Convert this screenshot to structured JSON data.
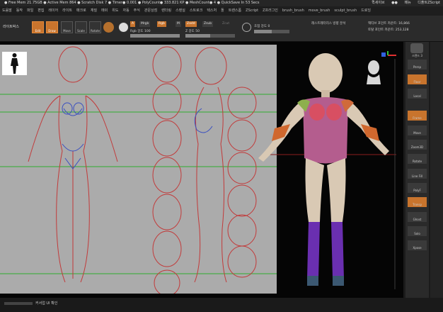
{
  "status_bar": {
    "text": "● Free Mem 21.75GB ● Active Mem 864 ● Scratch Disk 7 ● Timer● 0.001 ● PolyCount● 333.821 KP ● MeshCount● 4 ● QuickSave In 53 Secs",
    "right_items": [
      "퀵세이브",
      "●●",
      "메뉴",
      "디폴트ZScript"
    ]
  },
  "menu_bar": {
    "items": [
      "도움말",
      "동작",
      "파일",
      "편집",
      "레이어",
      "라이트",
      "매크로",
      "재질",
      "메쉬",
      "위도",
      "자동",
      "주식",
      "관문상점",
      "렌더링",
      "스텐실",
      "스트로크",
      "텍스처",
      "톨",
      "트랜스폼",
      "ZScript",
      "Z프러그인",
      "brush_brush",
      "move_brush",
      "sculpt_brush",
      "드로잉"
    ]
  },
  "toolbar": {
    "lightbox": "라이트박스",
    "tools": [
      "Edit",
      "Draw",
      "Move",
      "Scale",
      "Rotate"
    ],
    "mode_a": "A",
    "mrgb": "Mrgb",
    "rgb": "Rgb",
    "m": "M",
    "zadd": "Zadd",
    "zsub": "Zsub",
    "zcut": "Zcut",
    "rgb_intensity_label": "Rgb 강도",
    "rgb_intensity_value": "100",
    "z_intensity_label": "Z 강도",
    "z_intensity_value": "50",
    "focal_label": "초점 강도",
    "focal_value": "0",
    "document_title": "레스트레터리스 방향 분석",
    "active_points": "액티브 포인트 카운트: 16,866",
    "total_points": "토탈 포인트 카운트: 253,128"
  },
  "right_panel": {
    "items": [
      "스탠드 3",
      "Persp",
      "Floor",
      "Local",
      "Frame",
      "Move",
      "Zoom3D",
      "Rotate",
      "Line Fill",
      "PolyF",
      "Transp",
      "Ghost",
      "Solo",
      "Xpose"
    ]
  },
  "bottom_bar": {
    "label": "커서업 UI 확인"
  },
  "colors": {
    "accent": "#c8742d",
    "guide_line": "#2fae2f",
    "sheet": "#ababab"
  }
}
